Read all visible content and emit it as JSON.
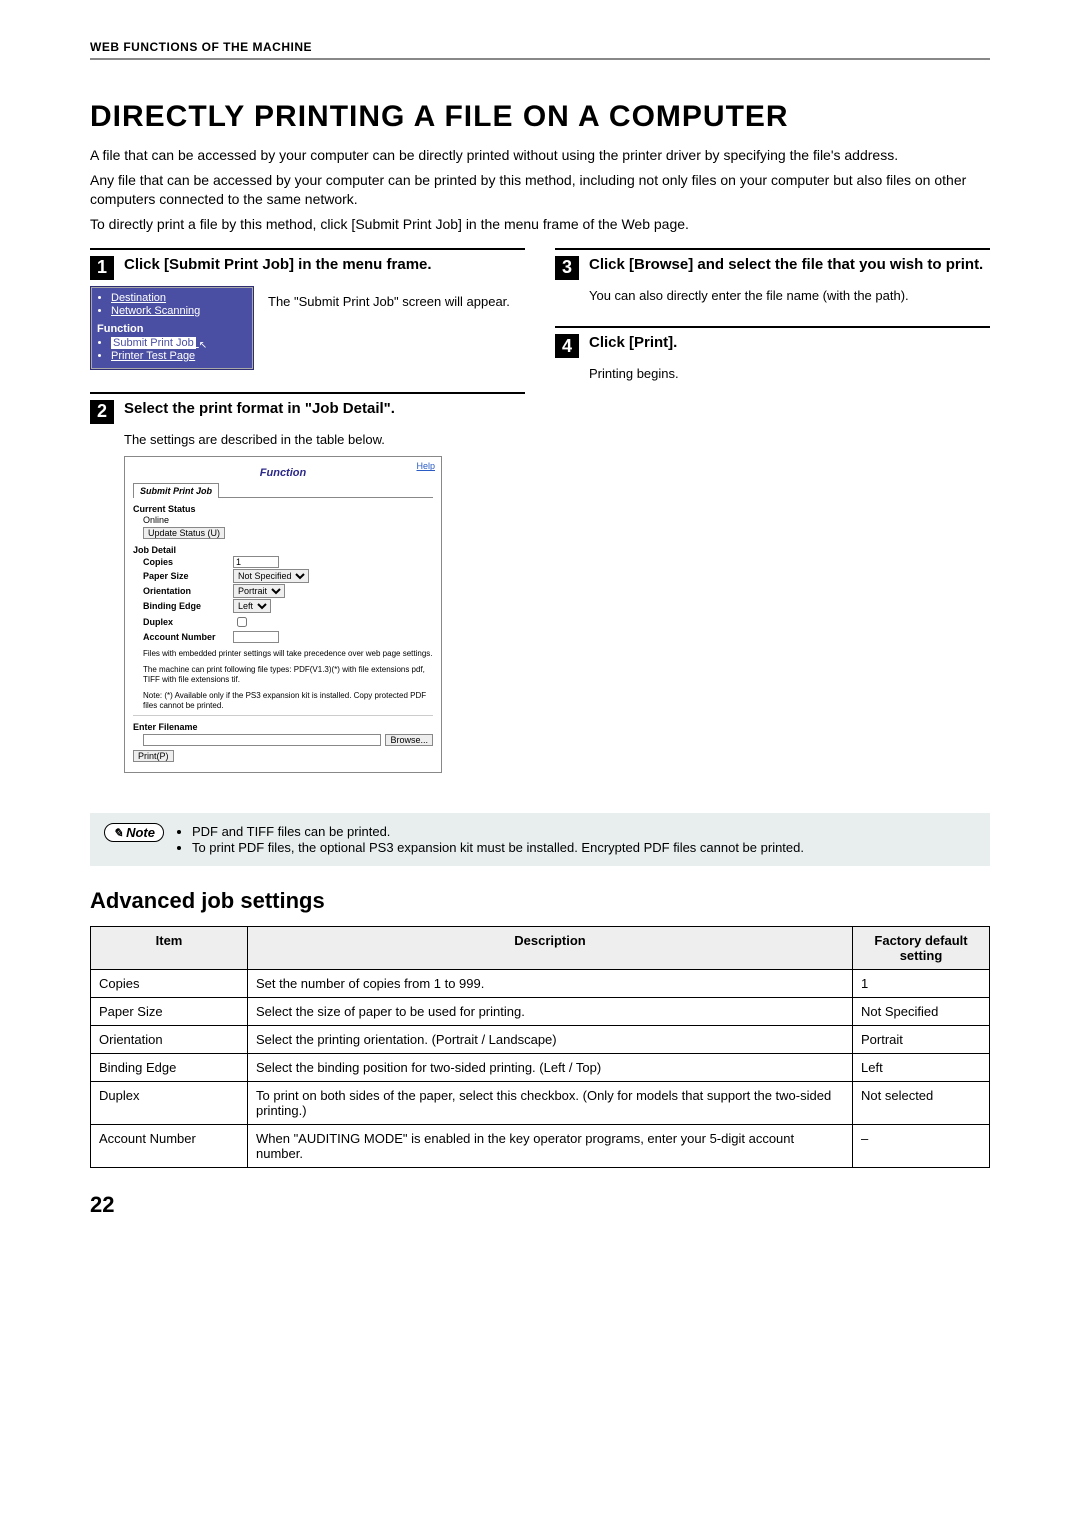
{
  "running_head": "WEB FUNCTIONS OF THE MACHINE",
  "title": "DIRECTLY PRINTING A FILE ON A COMPUTER",
  "intro": {
    "p1": "A file that can be accessed by your computer can be directly printed without using the printer driver by specifying the file's address.",
    "p2": "Any file that can be accessed by your computer can be printed by this method, including not only files on your computer but also files on other computers connected to the same network.",
    "p3": "To directly print a file by this method, click [Submit Print Job] in the menu frame of the Web page."
  },
  "steps": {
    "s1": {
      "num": "1",
      "title": "Click [Submit Print Job] in the menu frame.",
      "body": "The \"Submit Print Job\" screen will appear."
    },
    "s2": {
      "num": "2",
      "title": "Select the print format in \"Job Detail\".",
      "body": "The settings are described in the table below."
    },
    "s3": {
      "num": "3",
      "title": "Click [Browse] and select the file that you wish to print.",
      "body": "You can also directly enter the file name (with the path)."
    },
    "s4": {
      "num": "4",
      "title": "Click [Print].",
      "body": "Printing begins."
    }
  },
  "menu": {
    "destination": "Destination",
    "network_scanning": "Network Scanning",
    "function_label": "Function",
    "submit_print_job": "Submit Print Job",
    "printer_test_page": "Printer Test Page"
  },
  "form": {
    "help": "Help",
    "function_title": "Function",
    "tab": "Submit Print Job",
    "current_status_label": "Current Status",
    "current_status_value": "Online",
    "update_status_btn": "Update Status (U)",
    "job_detail_label": "Job Detail",
    "copies_label": "Copies",
    "copies_value": "1",
    "paper_size_label": "Paper Size",
    "paper_size_value": "Not Specified",
    "orientation_label": "Orientation",
    "orientation_value": "Portrait",
    "binding_edge_label": "Binding Edge",
    "binding_edge_value": "Left",
    "duplex_label": "Duplex",
    "account_number_label": "Account Number",
    "note1": "Files with embedded printer settings will take precedence over web page settings.",
    "note2": "The machine can print following file types: PDF(V1.3)(*) with file extensions pdf, TIFF with file extensions tif.",
    "note3": "Note: (*) Available only if the PS3 expansion kit is installed. Copy protected PDF files cannot be printed.",
    "enter_filename_label": "Enter Filename",
    "browse_btn": "Browse...",
    "print_btn": "Print(P)"
  },
  "note": {
    "badge": "Note",
    "li1": "PDF and TIFF files can be printed.",
    "li2": "To print PDF files, the optional PS3 expansion kit must be installed. Encrypted PDF files cannot be printed."
  },
  "advanced": {
    "heading": "Advanced job settings",
    "th_item": "Item",
    "th_desc": "Description",
    "th_default": "Factory default setting",
    "rows": [
      {
        "item": "Copies",
        "desc": "Set the number of copies from 1 to 999.",
        "def": "1"
      },
      {
        "item": "Paper Size",
        "desc": "Select the size of paper to be used for printing.",
        "def": "Not Specified"
      },
      {
        "item": "Orientation",
        "desc": "Select the printing orientation. (Portrait / Landscape)",
        "def": "Portrait"
      },
      {
        "item": "Binding Edge",
        "desc": "Select the binding position for two-sided printing. (Left / Top)",
        "def": "Left"
      },
      {
        "item": "Duplex",
        "desc": "To print on both sides of the paper, select this checkbox. (Only for models that support the two-sided printing.)",
        "def": "Not selected"
      },
      {
        "item": "Account Number",
        "desc": "When \"AUDITING MODE\" is enabled in the key operator programs, enter your 5-digit account number.",
        "def": "–"
      }
    ]
  },
  "page_number": "22"
}
